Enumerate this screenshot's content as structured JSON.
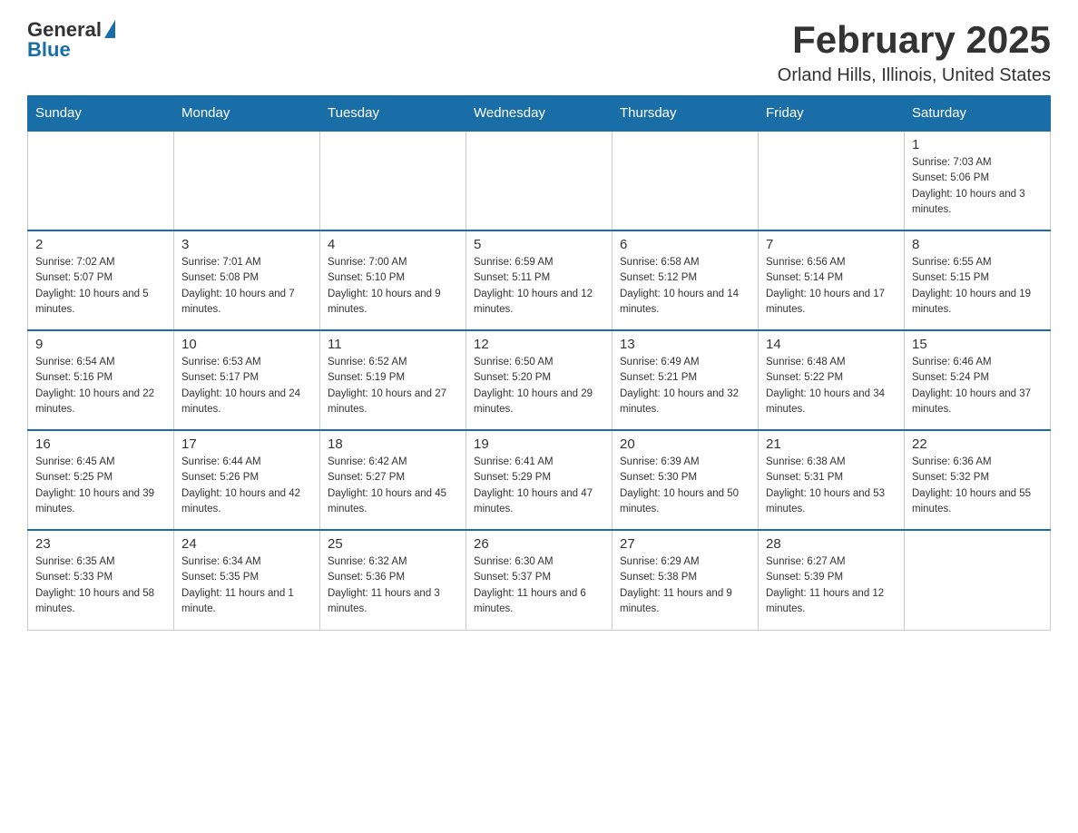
{
  "logo": {
    "general": "General",
    "blue": "Blue"
  },
  "title": "February 2025",
  "location": "Orland Hills, Illinois, United States",
  "days_of_week": [
    "Sunday",
    "Monday",
    "Tuesday",
    "Wednesday",
    "Thursday",
    "Friday",
    "Saturday"
  ],
  "weeks": [
    [
      {
        "day": "",
        "info": ""
      },
      {
        "day": "",
        "info": ""
      },
      {
        "day": "",
        "info": ""
      },
      {
        "day": "",
        "info": ""
      },
      {
        "day": "",
        "info": ""
      },
      {
        "day": "",
        "info": ""
      },
      {
        "day": "1",
        "info": "Sunrise: 7:03 AM\nSunset: 5:06 PM\nDaylight: 10 hours and 3 minutes."
      }
    ],
    [
      {
        "day": "2",
        "info": "Sunrise: 7:02 AM\nSunset: 5:07 PM\nDaylight: 10 hours and 5 minutes."
      },
      {
        "day": "3",
        "info": "Sunrise: 7:01 AM\nSunset: 5:08 PM\nDaylight: 10 hours and 7 minutes."
      },
      {
        "day": "4",
        "info": "Sunrise: 7:00 AM\nSunset: 5:10 PM\nDaylight: 10 hours and 9 minutes."
      },
      {
        "day": "5",
        "info": "Sunrise: 6:59 AM\nSunset: 5:11 PM\nDaylight: 10 hours and 12 minutes."
      },
      {
        "day": "6",
        "info": "Sunrise: 6:58 AM\nSunset: 5:12 PM\nDaylight: 10 hours and 14 minutes."
      },
      {
        "day": "7",
        "info": "Sunrise: 6:56 AM\nSunset: 5:14 PM\nDaylight: 10 hours and 17 minutes."
      },
      {
        "day": "8",
        "info": "Sunrise: 6:55 AM\nSunset: 5:15 PM\nDaylight: 10 hours and 19 minutes."
      }
    ],
    [
      {
        "day": "9",
        "info": "Sunrise: 6:54 AM\nSunset: 5:16 PM\nDaylight: 10 hours and 22 minutes."
      },
      {
        "day": "10",
        "info": "Sunrise: 6:53 AM\nSunset: 5:17 PM\nDaylight: 10 hours and 24 minutes."
      },
      {
        "day": "11",
        "info": "Sunrise: 6:52 AM\nSunset: 5:19 PM\nDaylight: 10 hours and 27 minutes."
      },
      {
        "day": "12",
        "info": "Sunrise: 6:50 AM\nSunset: 5:20 PM\nDaylight: 10 hours and 29 minutes."
      },
      {
        "day": "13",
        "info": "Sunrise: 6:49 AM\nSunset: 5:21 PM\nDaylight: 10 hours and 32 minutes."
      },
      {
        "day": "14",
        "info": "Sunrise: 6:48 AM\nSunset: 5:22 PM\nDaylight: 10 hours and 34 minutes."
      },
      {
        "day": "15",
        "info": "Sunrise: 6:46 AM\nSunset: 5:24 PM\nDaylight: 10 hours and 37 minutes."
      }
    ],
    [
      {
        "day": "16",
        "info": "Sunrise: 6:45 AM\nSunset: 5:25 PM\nDaylight: 10 hours and 39 minutes."
      },
      {
        "day": "17",
        "info": "Sunrise: 6:44 AM\nSunset: 5:26 PM\nDaylight: 10 hours and 42 minutes."
      },
      {
        "day": "18",
        "info": "Sunrise: 6:42 AM\nSunset: 5:27 PM\nDaylight: 10 hours and 45 minutes."
      },
      {
        "day": "19",
        "info": "Sunrise: 6:41 AM\nSunset: 5:29 PM\nDaylight: 10 hours and 47 minutes."
      },
      {
        "day": "20",
        "info": "Sunrise: 6:39 AM\nSunset: 5:30 PM\nDaylight: 10 hours and 50 minutes."
      },
      {
        "day": "21",
        "info": "Sunrise: 6:38 AM\nSunset: 5:31 PM\nDaylight: 10 hours and 53 minutes."
      },
      {
        "day": "22",
        "info": "Sunrise: 6:36 AM\nSunset: 5:32 PM\nDaylight: 10 hours and 55 minutes."
      }
    ],
    [
      {
        "day": "23",
        "info": "Sunrise: 6:35 AM\nSunset: 5:33 PM\nDaylight: 10 hours and 58 minutes."
      },
      {
        "day": "24",
        "info": "Sunrise: 6:34 AM\nSunset: 5:35 PM\nDaylight: 11 hours and 1 minute."
      },
      {
        "day": "25",
        "info": "Sunrise: 6:32 AM\nSunset: 5:36 PM\nDaylight: 11 hours and 3 minutes."
      },
      {
        "day": "26",
        "info": "Sunrise: 6:30 AM\nSunset: 5:37 PM\nDaylight: 11 hours and 6 minutes."
      },
      {
        "day": "27",
        "info": "Sunrise: 6:29 AM\nSunset: 5:38 PM\nDaylight: 11 hours and 9 minutes."
      },
      {
        "day": "28",
        "info": "Sunrise: 6:27 AM\nSunset: 5:39 PM\nDaylight: 11 hours and 12 minutes."
      },
      {
        "day": "",
        "info": ""
      }
    ]
  ]
}
